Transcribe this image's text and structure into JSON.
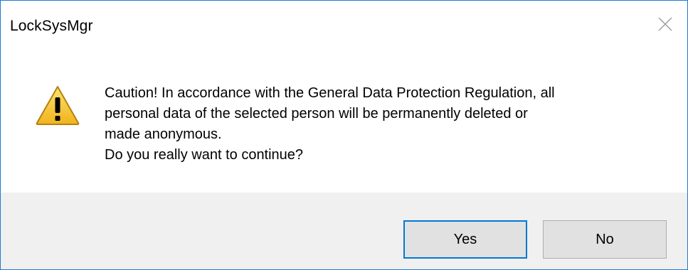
{
  "window": {
    "title": "LockSysMgr",
    "close_icon": "close-icon"
  },
  "message": {
    "icon": "warning-icon",
    "line1": "Caution! In accordance with the General Data Protection Regulation, all",
    "line2": "personal data of the selected person will be permanently deleted or",
    "line3": "made anonymous.",
    "line4": "Do you really want to continue?"
  },
  "buttons": {
    "yes_label": "Yes",
    "no_label": "No",
    "default": "Yes"
  },
  "colors": {
    "window_border": "#1f7ad1",
    "footer_bg": "#f0f0f0",
    "focused_button_border": "#0078d7",
    "warning_fill": "#f5c232"
  }
}
